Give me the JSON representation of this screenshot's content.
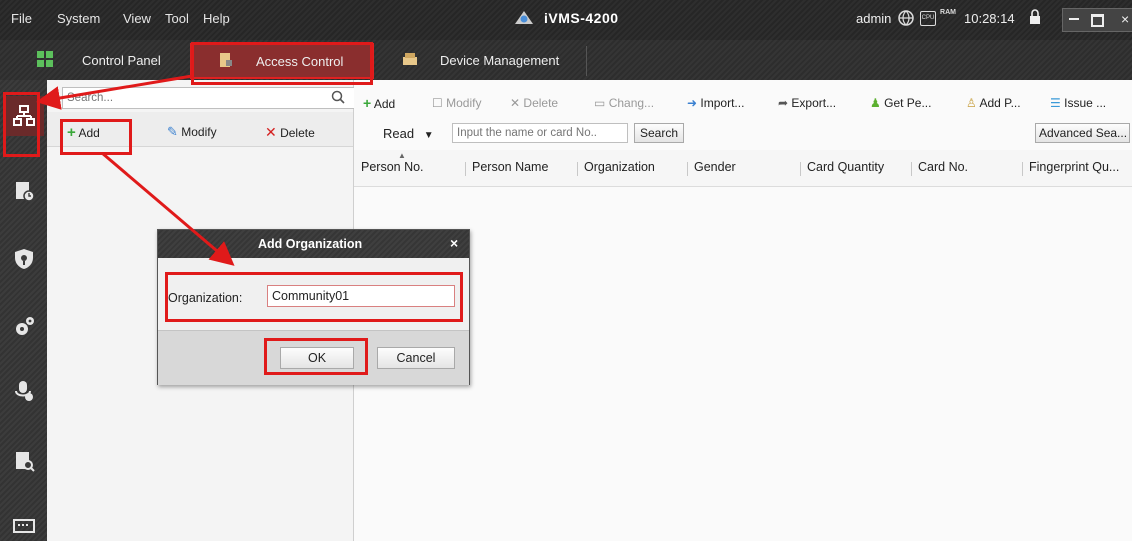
{
  "menu": {
    "file": "File",
    "system": "System",
    "view": "View",
    "tool": "Tool",
    "help": "Help"
  },
  "app_title": "iVMS-4200",
  "status": {
    "user": "admin",
    "cpu_label": "CPU",
    "ram_label": "RAM",
    "time": "10:28:14"
  },
  "tabs": [
    {
      "label": "Control Panel"
    },
    {
      "label": "Access Control"
    },
    {
      "label": "Device Management"
    }
  ],
  "org_panel": {
    "search_placeholder": "Search...",
    "add_label": "Add",
    "modify_label": "Modify",
    "delete_label": "Delete"
  },
  "toolbar": {
    "add": "Add",
    "modify": "Modify",
    "delete": "Delete",
    "change": "Chang...",
    "import": "Import...",
    "export": "Export...",
    "get_person": "Get Pe...",
    "add_person": "Add P...",
    "issue": "Issue ..."
  },
  "filter": {
    "read_label": "Read",
    "search_placeholder": "Input the name or card No..",
    "search_button": "Search",
    "advanced_search": "Advanced Sea..."
  },
  "table": {
    "columns": [
      "Person No.",
      "Person Name",
      "Organization",
      "Gender",
      "Card Quantity",
      "Card No.",
      "Fingerprint Qu..."
    ]
  },
  "dialog": {
    "title": "Add Organization",
    "close": "×",
    "field_label": "Organization:",
    "field_value": "Community01",
    "ok": "OK",
    "cancel": "Cancel"
  },
  "colors": {
    "highlight_red": "#e01a1a",
    "active_tab": "#8a2e2e",
    "add_green": "#3aa83a",
    "delete_red": "#d42020"
  }
}
